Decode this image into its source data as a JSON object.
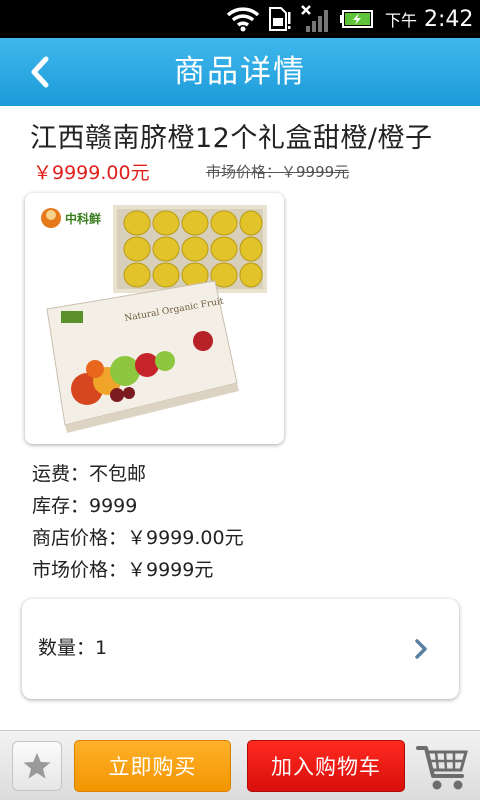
{
  "status_bar": {
    "ampm": "下午",
    "time": "2:42",
    "icons": [
      "wifi-icon",
      "sim-card-icon",
      "no-signal-icon",
      "battery-charging-icon"
    ]
  },
  "header": {
    "title": "商品详情",
    "back_icon": "chevron-left-icon"
  },
  "product": {
    "name": "江西赣南脐橙12个礼盒甜橙/橙子",
    "price": "￥9999.00元",
    "market_price_strike": "市场价格：￥9999元",
    "image_brand_text": "中科鲜",
    "image_box_text": "Natural Organic Fruit"
  },
  "details": {
    "freight": "运费：不包邮",
    "stock": "库存：9999",
    "shop_price": "商店价格：￥9999.00元",
    "market_price": "市场价格：￥9999元"
  },
  "quantity": {
    "label": "数量：1"
  },
  "bottom_bar": {
    "buy_now": "立即购买",
    "add_to_cart": "加入购物车",
    "favorite_icon": "star-icon",
    "cart_icon": "shopping-cart-icon"
  },
  "colors": {
    "header_blue": "#1c9bd9",
    "price_red": "#e1201b",
    "buy_orange": "#f29500",
    "cart_red": "#d80e0a"
  }
}
